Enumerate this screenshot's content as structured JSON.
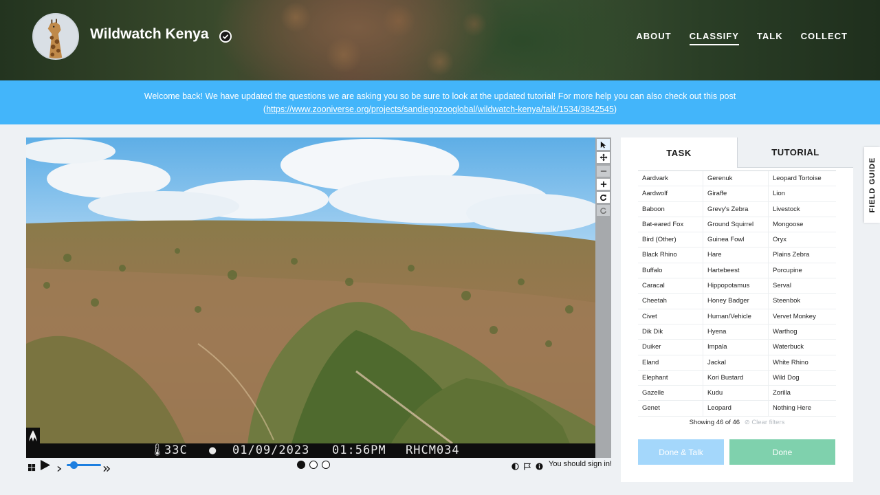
{
  "header": {
    "project_title": "Wildwatch Kenya",
    "nav": [
      {
        "label": "ABOUT",
        "active": false
      },
      {
        "label": "CLASSIFY",
        "active": true
      },
      {
        "label": "TALK",
        "active": false
      },
      {
        "label": "COLLECT",
        "active": false
      }
    ]
  },
  "announcement": {
    "text": "Welcome back! We have updated the questions we are asking you so be sure to look at the updated tutorial! For more help you can also check out this post",
    "link_open": "(",
    "link": "https://www.zooniverse.org/projects/sandiegozooglobal/wildwatch-kenya/talk/1534/3842545",
    "link_close": ")"
  },
  "camera_overlay": {
    "temperature": "33C",
    "date": "01/09/2023",
    "time": "01:56PM",
    "camera_id": "RHCM034"
  },
  "controls": {
    "frame_count": 3,
    "current_frame": 1,
    "sign_in_text": "You should sign in!"
  },
  "task_panel": {
    "tabs": [
      {
        "label": "TASK",
        "active": true
      },
      {
        "label": "TUTORIAL",
        "active": false
      }
    ],
    "species": [
      "Aardvark",
      "Gerenuk",
      "Leopard Tortoise",
      "Aardwolf",
      "Giraffe",
      "Lion",
      "Baboon",
      "Grevy's Zebra",
      "Livestock",
      "Bat-eared Fox",
      "Ground Squirrel",
      "Mongoose",
      "Bird (Other)",
      "Guinea Fowl",
      "Oryx",
      "Black Rhino",
      "Hare",
      "Plains Zebra",
      "Buffalo",
      "Hartebeest",
      "Porcupine",
      "Caracal",
      "Hippopotamus",
      "Serval",
      "Cheetah",
      "Honey Badger",
      "Steenbok",
      "Civet",
      "Human/Vehicle",
      "Vervet Monkey",
      "Dik Dik",
      "Hyena",
      "Warthog",
      "Duiker",
      "Impala",
      "Waterbuck",
      "Eland",
      "Jackal",
      "White Rhino",
      "Elephant",
      "Kori Bustard",
      "Wild Dog",
      "Gazelle",
      "Kudu",
      "Zorilla",
      "Genet",
      "Leopard",
      "Nothing Here"
    ],
    "showing_text": "Showing 46 of 46",
    "clear_filters": "Clear filters",
    "done_talk_label": "Done & Talk",
    "done_label": "Done"
  },
  "field_guide_label": "FIELD GUIDE",
  "colors": {
    "announcement_bg": "#43b5fa",
    "done_talk_bg": "#a4d7fb",
    "done_bg": "#7fd1ad",
    "slider": "#1d7fe0"
  }
}
